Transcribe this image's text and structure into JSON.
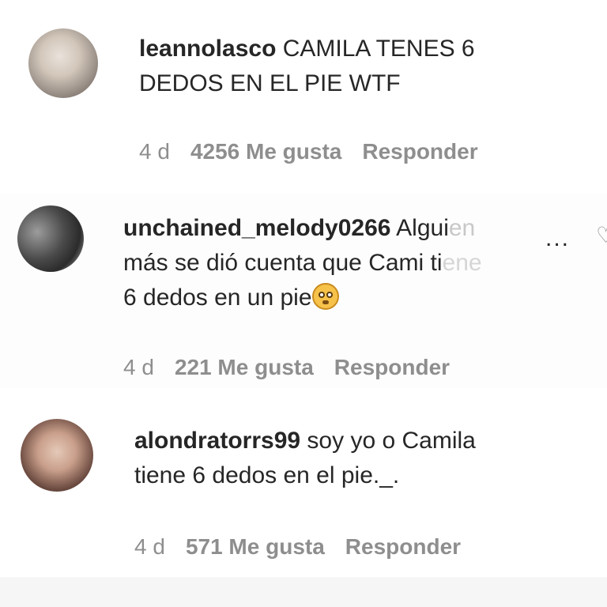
{
  "comments": [
    {
      "username": "leannolasco",
      "text_line1": "CAMILA TENES 6",
      "text_line2": "DEDOS EN EL PIE WTF",
      "time": "4 d",
      "likes": "4256 Me gusta",
      "reply": "Responder"
    },
    {
      "username": "unchained_melody0266",
      "text_line1": "Algui",
      "text_line1_faded": "en",
      "text_line2": "más se dió cuenta que Cami ti",
      "text_line2_faded": "ene",
      "text_line3": "6 dedos en un pie",
      "emoji": "flushed-face-emoji",
      "more": "...",
      "time": "4 d",
      "likes": "221 Me gusta",
      "reply": "Responder"
    },
    {
      "username": "alondratorrs99",
      "text_line1": "soy yo o Camila",
      "text_line2": "tiene 6 dedos en el pie._.",
      "time": "4 d",
      "likes": "571 Me gusta",
      "reply": "Responder"
    }
  ],
  "colors": {
    "text": "#262626",
    "meta": "#8e8e8e",
    "background": "#ffffff"
  }
}
